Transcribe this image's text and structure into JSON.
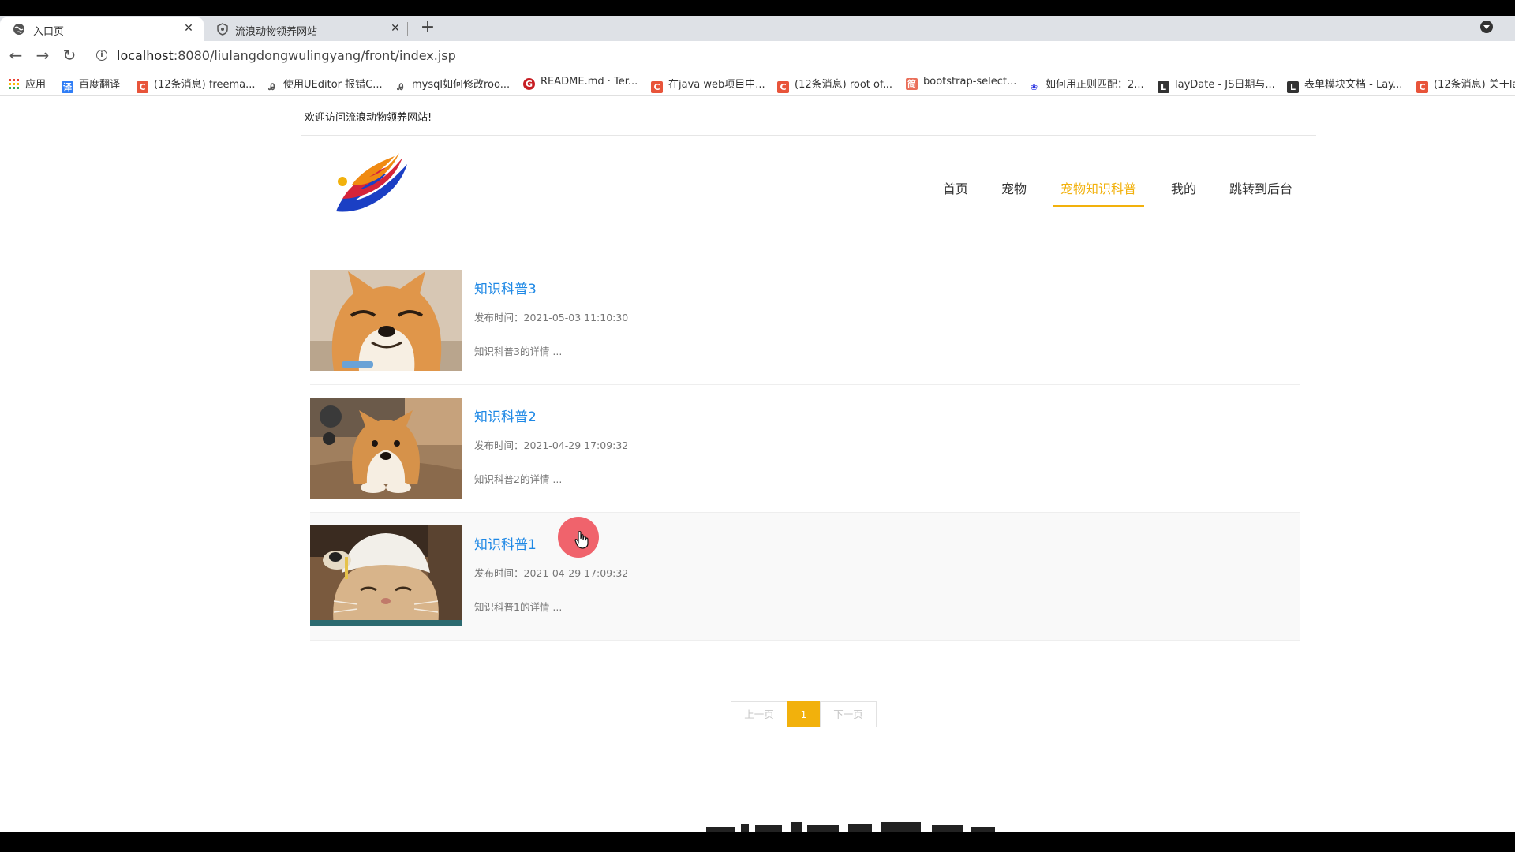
{
  "browser": {
    "tabs": [
      {
        "title": "入口页",
        "active": true,
        "icon": "globe-icon"
      },
      {
        "title": "流浪动物领养网站",
        "active": false,
        "icon": "shield-icon"
      }
    ],
    "new_tab": "+",
    "url": {
      "host": "localhost",
      "rest": ":8080/liulangdongwulingyang/front/index.jsp"
    },
    "bookmarks": [
      {
        "label": "应用",
        "icon": "apps-grid-icon",
        "color": "#e94235"
      },
      {
        "label": "百度翻译",
        "icon": "translate-icon",
        "color": "#2f7df6"
      },
      {
        "label": "(12条消息) freema...",
        "icon": "csdn-icon",
        "color": "#e8543a"
      },
      {
        "label": "使用UEditor 报错C...",
        "icon": "bookmark-icon",
        "color": "#555555"
      },
      {
        "label": "mysql如何修改roo...",
        "icon": "bookmark-icon",
        "color": "#555555"
      },
      {
        "label": "README.md · Ter...",
        "icon": "gitee-icon",
        "color": "#c71d23"
      },
      {
        "label": "在java web项目中...",
        "icon": "csdn-icon",
        "color": "#e8543a"
      },
      {
        "label": "(12条消息) root of...",
        "icon": "csdn-icon",
        "color": "#e8543a"
      },
      {
        "label": "bootstrap-select...",
        "icon": "jianshu-icon",
        "color": "#ea6f5a"
      },
      {
        "label": "如何用正则匹配：2...",
        "icon": "baidu-icon",
        "color": "#2932e1"
      },
      {
        "label": "layDate - JS日期与...",
        "icon": "layui-icon",
        "color": "#333333"
      },
      {
        "label": "表单模块文档 - Lay...",
        "icon": "layui-icon",
        "color": "#333333"
      },
      {
        "label": "(12条消息) 关于la",
        "icon": "csdn-icon",
        "color": "#e8543a"
      }
    ]
  },
  "site": {
    "welcome": "欢迎访问流浪动物领养网站!",
    "nav": [
      {
        "label": "首页",
        "active": false
      },
      {
        "label": "宠物",
        "active": false
      },
      {
        "label": "宠物知识科普",
        "active": true
      },
      {
        "label": "我的",
        "active": false
      },
      {
        "label": "跳转到后台",
        "active": false
      }
    ],
    "accent": "#f2b10c",
    "link_color": "#1e88e5"
  },
  "articles": [
    {
      "title": "知识科普3",
      "time": "发布时间：2021-05-03 11:10:30",
      "desc": "知识科普3的详情 ...",
      "image": "shiba-smiling"
    },
    {
      "title": "知识科普2",
      "time": "发布时间：2021-04-29 17:09:32",
      "desc": "知识科普2的详情 ...",
      "image": "shiba-lying"
    },
    {
      "title": "知识科普1",
      "time": "发布时间：2021-04-29 17:09:32",
      "desc": "知识科普1的详情 ...",
      "image": "cat-with-hat"
    }
  ],
  "pagination": {
    "prev": "上一页",
    "current": "1",
    "next": "下一页"
  }
}
